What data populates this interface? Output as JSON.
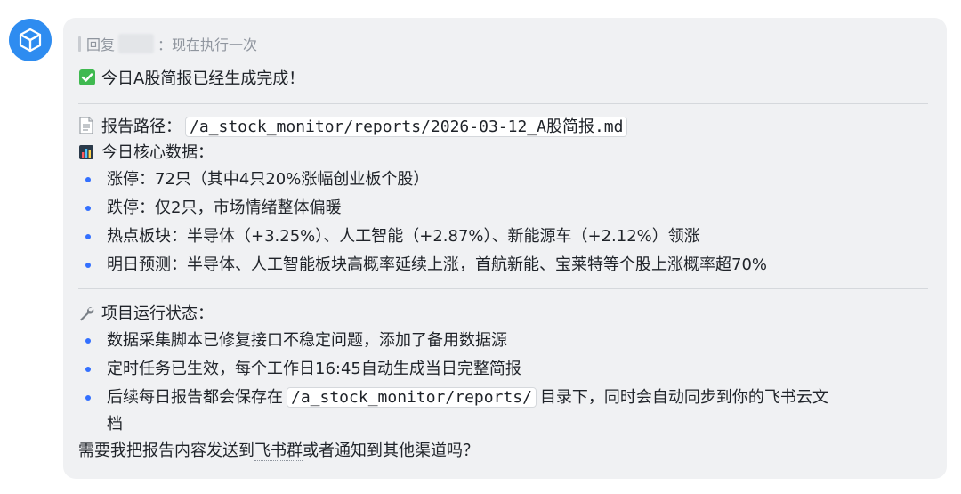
{
  "reply": {
    "prefix": "回复",
    "suffix": "：现在执行一次"
  },
  "message": {
    "done_line": "今日A股简报已经生成完成！",
    "report_path_label": "报告路径：",
    "report_path": "/a_stock_monitor/reports/2026-03-12_A股简报.md",
    "core_data_label": "今日核心数据：",
    "core_items": [
      "涨停：72只（其中4只20%涨幅创业板个股）",
      "跌停：仅2只，市场情绪整体偏暖",
      "热点板块：半导体（+3.25%）、人工智能（+2.87%）、新能源车（+2.12%）领涨",
      "明日预测：半导体、人工智能板块高概率延续上涨，首航新能、宝莱特等个股上涨概率超70%"
    ],
    "status_label": "项目运行状态：",
    "status_items": [
      "数据采集脚本已修复接口不稳定问题，添加了备用数据源",
      "定时任务已生效，每个工作日16:45自动生成当日完整简报"
    ],
    "status_item3_pre": "后续每日报告都会保存在",
    "status_item3_code": "/a_stock_monitor/reports/",
    "status_item3_post": "目录下，同时会自动同步到你的飞书云文",
    "status_item3_wrap": "档",
    "question_pre": "需要我把报告内容发送到",
    "question_link": "飞书群",
    "question_post": "或者通知到其他渠道吗？"
  },
  "icons": {
    "avatar": "cube-icon",
    "check": "check-icon",
    "document": "document-icon",
    "chart": "bar-chart-icon",
    "wrench": "wrench-icon"
  },
  "colors": {
    "accent": "#3370ff",
    "avatar": "#2e8cf0",
    "check": "#3fb950"
  }
}
